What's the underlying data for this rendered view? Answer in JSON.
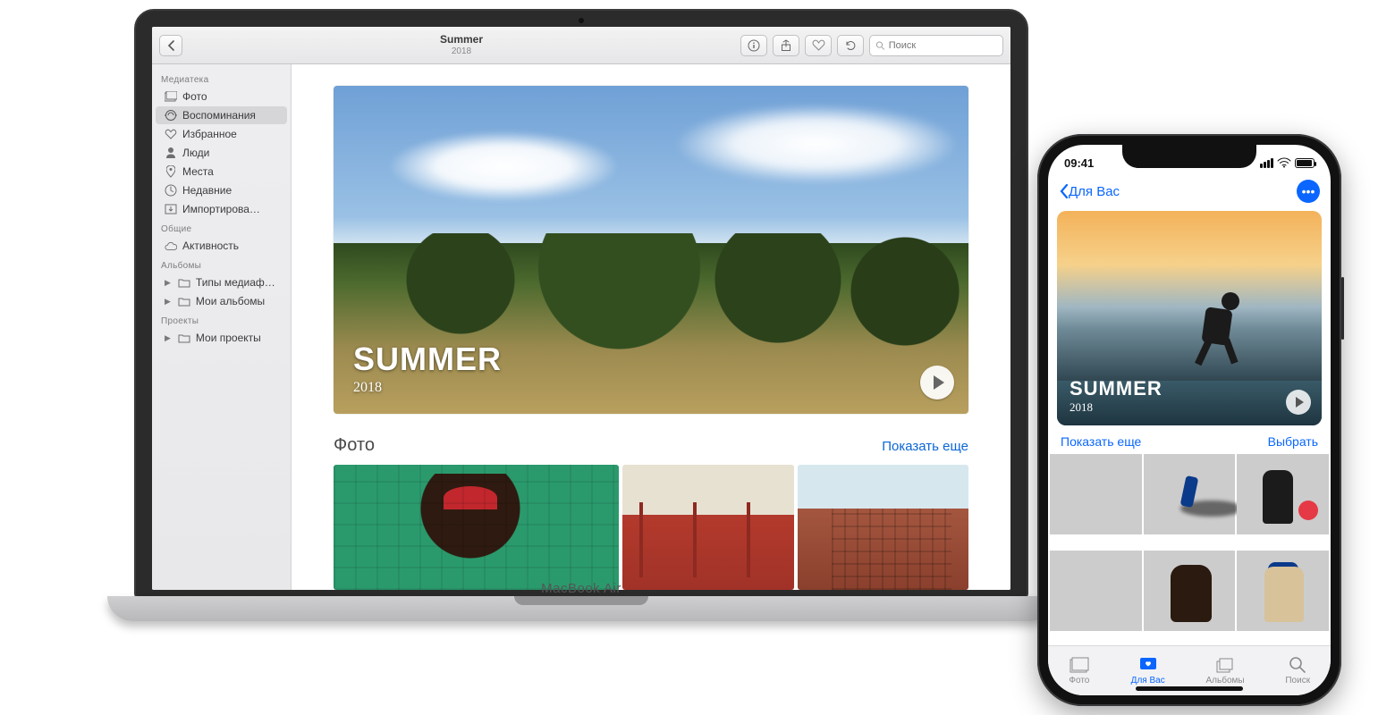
{
  "macbook": {
    "device_label": "MacBook Air"
  },
  "toolbar": {
    "title": "Summer",
    "subtitle": "2018",
    "search_placeholder": "Поиск"
  },
  "sidebar": {
    "groups": [
      {
        "title": "Медиатека",
        "items": [
          {
            "label": "Фото",
            "icon": "photos"
          },
          {
            "label": "Воспоминания",
            "icon": "memories",
            "selected": true
          },
          {
            "label": "Избранное",
            "icon": "heart"
          },
          {
            "label": "Люди",
            "icon": "person"
          },
          {
            "label": "Места",
            "icon": "pin"
          },
          {
            "label": "Недавние",
            "icon": "clock"
          },
          {
            "label": "Импортирова…",
            "icon": "import"
          }
        ]
      },
      {
        "title": "Общие",
        "items": [
          {
            "label": "Активность",
            "icon": "cloud"
          }
        ]
      },
      {
        "title": "Альбомы",
        "items": [
          {
            "label": "Типы медиаф…",
            "icon": "folder",
            "arrow": true
          },
          {
            "label": "Мои альбомы",
            "icon": "folder",
            "arrow": true
          }
        ]
      },
      {
        "title": "Проекты",
        "items": [
          {
            "label": "Мои проекты",
            "icon": "folder",
            "arrow": true
          }
        ]
      }
    ]
  },
  "hero": {
    "title": "SUMMER",
    "year": "2018"
  },
  "section": {
    "title": "Фото",
    "link": "Показать еще"
  },
  "iphone": {
    "status_time": "09:41",
    "back_label": "Для Вас",
    "hero": {
      "title": "SUMMER",
      "year": "2018"
    },
    "row": {
      "show_more": "Показать еще",
      "select": "Выбрать"
    },
    "tabs": {
      "photos": "Фото",
      "for_you": "Для Вас",
      "albums": "Альбомы",
      "search": "Поиск"
    }
  }
}
